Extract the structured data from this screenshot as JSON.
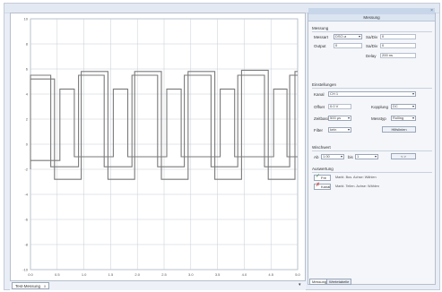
{
  "panel": {
    "header": "Messung",
    "measurement": {
      "title": "Messung",
      "channel_label": "Messart",
      "channel_value": "DSO-a",
      "output_label": "Output",
      "output_value": "0",
      "sample_label": "Sa/Div",
      "sample_value": "0",
      "sample2_label": "Sa/Div",
      "sample2_value": "0",
      "delay_label": "Delay",
      "delay_value": "200 ns"
    },
    "settings": {
      "title": "Einstellungen",
      "source_label": "Kanal",
      "source_value": "CH 1",
      "offset_label": "Offset",
      "offset_value": "0.0 V",
      "coupling_label": "Kopplung",
      "coupling_value": "DC",
      "time_label": "Zeitbasis",
      "time_value": "500 µs",
      "mode_label": "Messtyp",
      "mode_value": "Rolling",
      "filter_label": "Filter",
      "filter_value": "kein",
      "apply_button": "Hilfslinien"
    },
    "trigger": {
      "title": "Wischwert",
      "from_label": "Ab",
      "from_value": "1.00",
      "to_label": "bis",
      "to_value": "1",
      "range_button": "< >"
    },
    "output": {
      "title": "Auswertung",
      "check1_label": "Fre",
      "check1_hint": "Markt.  Bus. Achse: Wählen",
      "check2_label": "Kanal",
      "check2_hint": "Markt.  Teilen. Achse: Wählen"
    },
    "bottom_tabs": [
      "Messung",
      "Wertetabelle"
    ]
  },
  "tab": {
    "label": "Test-Messung",
    "close": "x"
  },
  "icons": {
    "tab_close": "close-icon",
    "scroll": "arrow-down-icon",
    "dropdown": "chevron-down-icon",
    "check": "check-icon"
  },
  "colors": {
    "trace": "#7a7a7a",
    "grid": "#c6cdd6",
    "accent": "#c8d6ea",
    "checkbox_red": "#d03a3a",
    "checkbox_green": "#3a8a3a"
  },
  "chart_data": {
    "type": "line",
    "x_ticks": [
      "0.0",
      "0.5",
      "1.0",
      "1.5",
      "2.0",
      "2.5",
      "3.0",
      "3.5",
      "4.0",
      "4.5",
      "5.0"
    ],
    "y_ticks": [
      "10",
      "8",
      "6",
      "4",
      "2",
      "0",
      "-2",
      "-4",
      "-6",
      "-8",
      "-10"
    ],
    "xlim": [
      0,
      5
    ],
    "ylim": [
      -10,
      10
    ],
    "grid": true,
    "series": [
      {
        "values": [
          [
            0.0,
            -2.0
          ],
          [
            0.0,
            5.5
          ],
          [
            0.38,
            5.5
          ],
          [
            0.38,
            -1.8
          ],
          [
            0.9,
            -1.8
          ],
          [
            0.9,
            5.5
          ],
          [
            1.38,
            5.5
          ],
          [
            1.38,
            -1.8
          ],
          [
            1.9,
            -1.8
          ],
          [
            1.9,
            5.5
          ],
          [
            2.38,
            5.5
          ],
          [
            2.38,
            -1.8
          ],
          [
            2.88,
            -1.8
          ],
          [
            2.88,
            5.5
          ],
          [
            3.38,
            5.5
          ],
          [
            3.38,
            -1.8
          ],
          [
            3.88,
            -1.8
          ],
          [
            3.88,
            5.5
          ],
          [
            4.38,
            5.5
          ],
          [
            4.38,
            -1.8
          ],
          [
            4.85,
            -1.8
          ],
          [
            4.85,
            5.5
          ],
          [
            5.0,
            5.5
          ]
        ]
      },
      {
        "values": [
          [
            0.0,
            -1.3
          ],
          [
            0.55,
            -1.3
          ],
          [
            0.55,
            4.4
          ],
          [
            0.82,
            4.4
          ],
          [
            0.82,
            -1.0
          ],
          [
            1.55,
            -1.0
          ],
          [
            1.55,
            4.4
          ],
          [
            1.82,
            4.4
          ],
          [
            1.82,
            -1.0
          ],
          [
            2.55,
            -1.0
          ],
          [
            2.55,
            4.4
          ],
          [
            2.82,
            4.4
          ],
          [
            2.82,
            -1.0
          ],
          [
            3.55,
            -1.0
          ],
          [
            3.55,
            4.4
          ],
          [
            3.82,
            4.4
          ],
          [
            3.82,
            -1.0
          ],
          [
            4.55,
            -1.0
          ],
          [
            4.55,
            4.4
          ],
          [
            4.8,
            4.4
          ],
          [
            4.8,
            -1.0
          ],
          [
            5.0,
            -1.0
          ]
        ]
      },
      {
        "values": [
          [
            0.0,
            5.2
          ],
          [
            0.45,
            5.2
          ],
          [
            0.45,
            -2.8
          ],
          [
            0.95,
            -2.8
          ],
          [
            0.95,
            5.8
          ],
          [
            1.45,
            5.8
          ],
          [
            1.45,
            -2.8
          ],
          [
            1.95,
            -2.8
          ],
          [
            1.95,
            5.8
          ],
          [
            2.45,
            5.8
          ],
          [
            2.45,
            -2.8
          ],
          [
            2.95,
            -2.8
          ],
          [
            2.95,
            5.8
          ],
          [
            3.45,
            5.8
          ],
          [
            3.45,
            -2.8
          ],
          [
            3.95,
            -2.8
          ],
          [
            3.95,
            5.9
          ],
          [
            4.45,
            5.9
          ],
          [
            4.45,
            -2.8
          ],
          [
            4.95,
            -2.8
          ],
          [
            4.95,
            5.8
          ],
          [
            5.0,
            5.8
          ]
        ]
      }
    ]
  }
}
